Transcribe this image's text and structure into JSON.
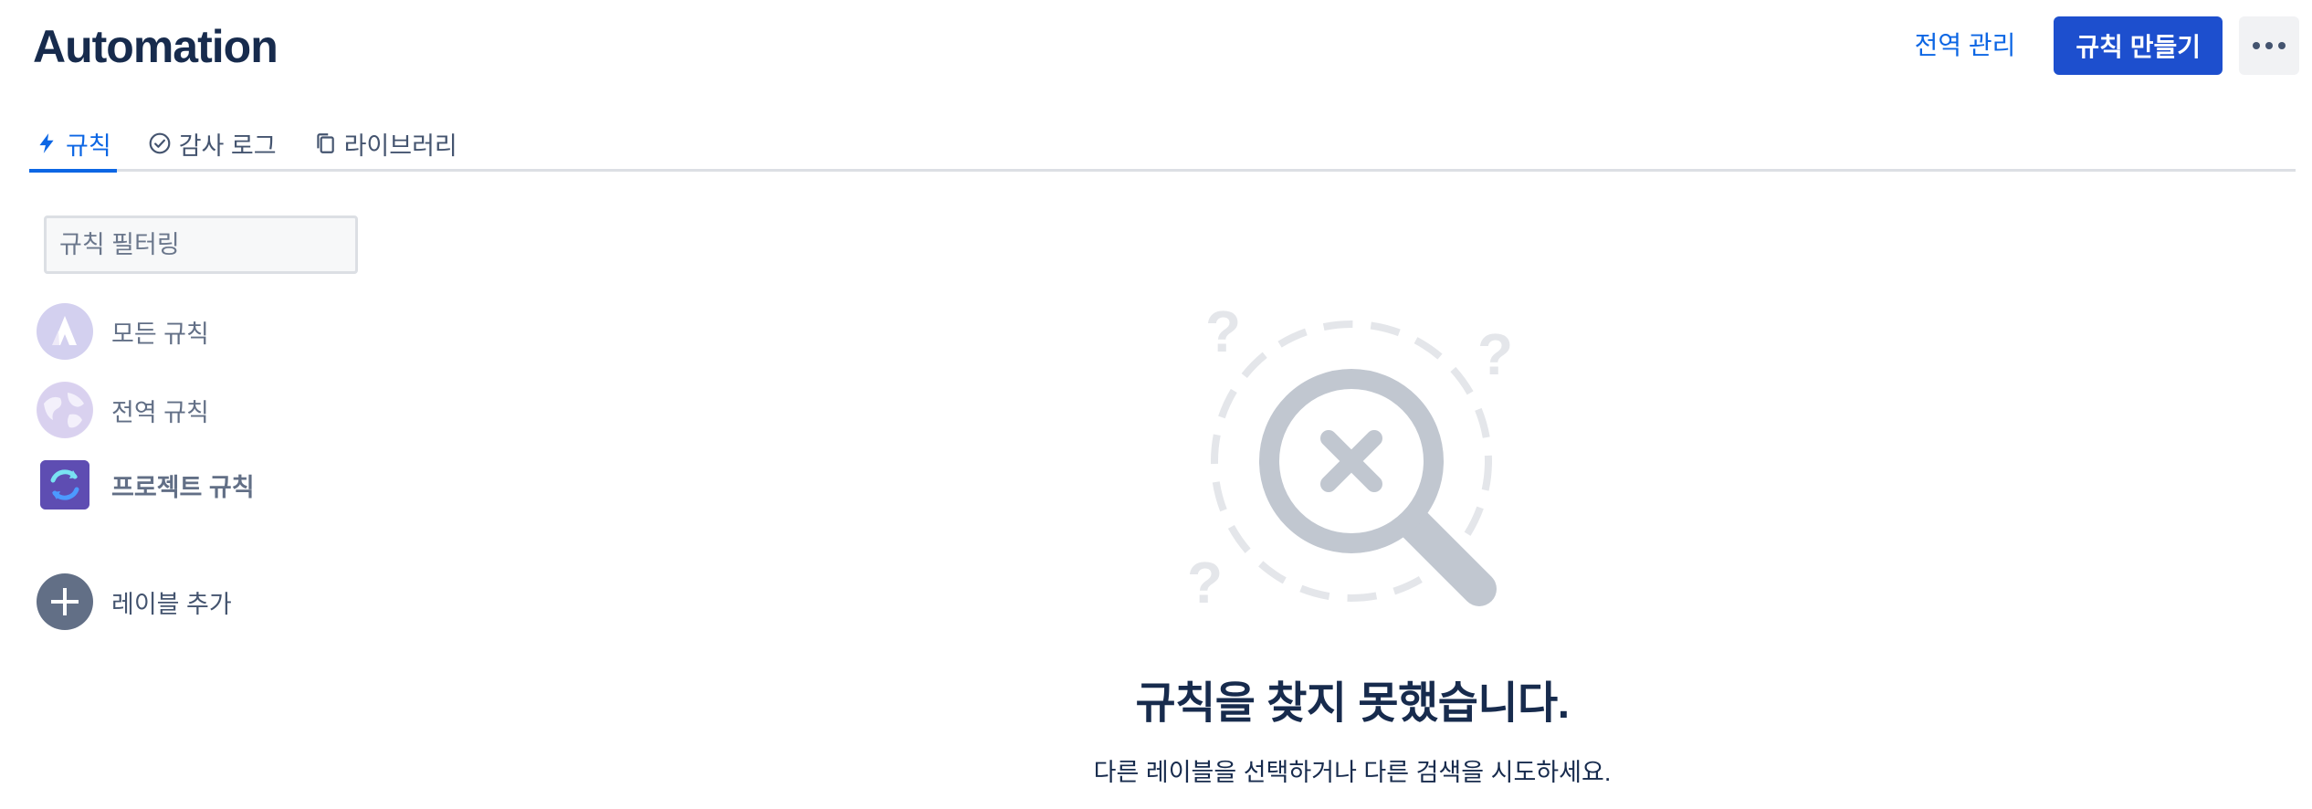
{
  "app": {
    "title": "Automation"
  },
  "header": {
    "manage_global_label": "전역 관리",
    "create_rule_label": "규칙 만들기",
    "more_icon": "more-horizontal-icon"
  },
  "tabs": [
    {
      "label": "규칙",
      "icon": "lightning-icon",
      "active": true
    },
    {
      "label": "감사 로그",
      "icon": "check-circle-icon",
      "active": false
    },
    {
      "label": "라이브러리",
      "icon": "copy-icon",
      "active": false
    }
  ],
  "sidebar": {
    "filter": {
      "placeholder": "규칙 필터링",
      "value": ""
    },
    "items": [
      {
        "label": "모든 규칙",
        "icon": "atlassian-logo-icon"
      },
      {
        "label": "전역 규칙",
        "icon": "globe-icon"
      },
      {
        "label": "프로젝트 규칙",
        "icon": "project-avatar-icon"
      }
    ],
    "add_label": "레이블 추가"
  },
  "empty_state": {
    "title": "규칙을 찾지 못했습니다.",
    "description": "다른 레이블을 선택하거나 다른 검색을 시도하세요."
  },
  "colors": {
    "brand": "#1d4fce",
    "link": "#0c66e4",
    "text": "#172b4d"
  }
}
